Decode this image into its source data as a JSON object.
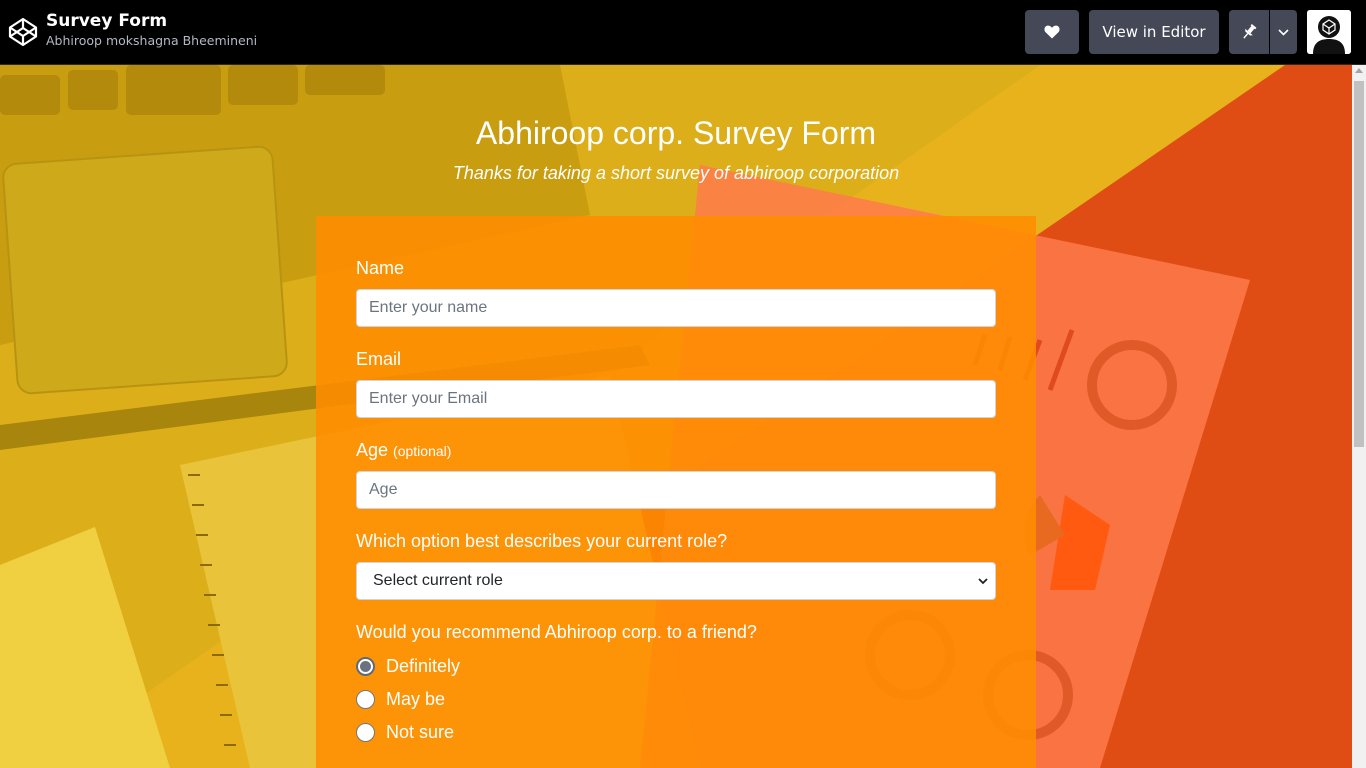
{
  "topbar": {
    "title": "Survey Form",
    "author": "Abhiroop mokshagna Bheemineni",
    "view_in_editor_label": "View in Editor",
    "icons": [
      "codepen-logo-icon",
      "heart-icon",
      "pin-icon",
      "chevron-down-icon",
      "avatar"
    ]
  },
  "page": {
    "heading": "Abhiroop corp. Survey Form",
    "subheading": "Thanks for taking a short survey of abhiroop corporation"
  },
  "form": {
    "name_label": "Name",
    "name_placeholder": "Enter your name",
    "email_label": "Email",
    "email_placeholder": "Enter your Email",
    "age_label": "Age",
    "age_optional": "(optional)",
    "age_placeholder": "Age",
    "role_label": "Which option best describes your current role?",
    "role_selected": "Select current role",
    "recommend_label": "Would you recommend Abhiroop corp. to a friend?",
    "recommend_options": [
      {
        "label": "Definitely",
        "checked": true
      },
      {
        "label": "May be",
        "checked": false
      },
      {
        "label": "Not sure",
        "checked": false
      }
    ]
  },
  "colors": {
    "card": "#ff8c00",
    "topbar": "#000000",
    "button": "#444857",
    "background_orange": "#e04a10",
    "background_yellow": "#e8b81a"
  }
}
